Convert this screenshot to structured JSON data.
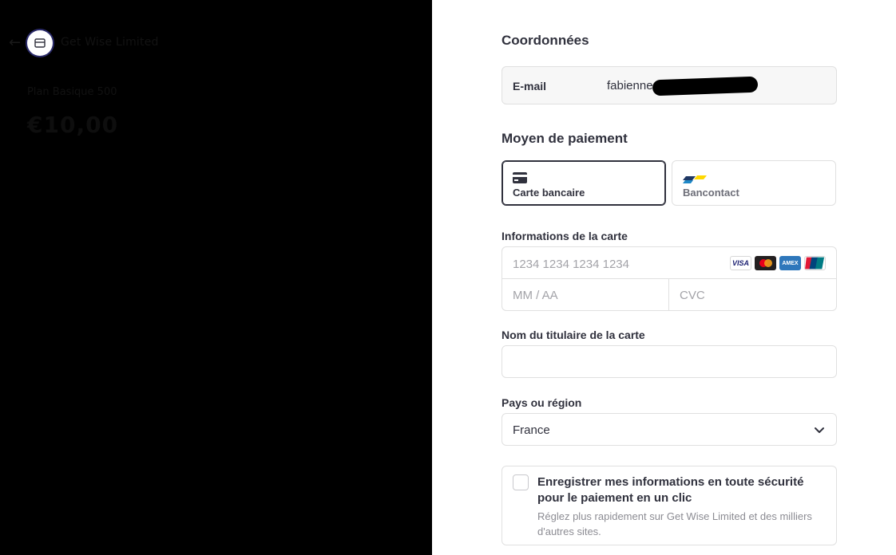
{
  "merchant": {
    "name": "Get Wise Limited",
    "product": "Plan Basique 500",
    "price": "€10,00"
  },
  "contact": {
    "title": "Coordonnées",
    "email_label": "E-mail",
    "email_value": "fabienne"
  },
  "payment_method": {
    "title": "Moyen de paiement",
    "tabs": [
      {
        "label": "Carte bancaire",
        "icon": "credit-card-icon",
        "selected": true
      },
      {
        "label": "Bancontact",
        "icon": "bancontact-icon",
        "selected": false
      }
    ]
  },
  "card": {
    "label": "Informations de la carte",
    "number_placeholder": "1234 1234 1234 1234",
    "expiry_placeholder": "MM / AA",
    "cvc_placeholder": "CVC",
    "brands": [
      "VISA",
      "Mastercard",
      "AMEX",
      "UnionPay"
    ]
  },
  "cardholder": {
    "label": "Nom du titulaire de la carte",
    "value": ""
  },
  "country": {
    "label": "Pays ou région",
    "value": "France"
  },
  "save_info": {
    "title": "Enregistrer mes informations en toute sécurité pour le paiement en un clic",
    "description": "Réglez plus rapidement sur Get Wise Limited et des milliers d'autres sites.",
    "checked": false
  },
  "colors": {
    "left_panel": "#000000",
    "text": "#30313d",
    "muted": "#8c8c93",
    "border": "#e0e0e0"
  }
}
